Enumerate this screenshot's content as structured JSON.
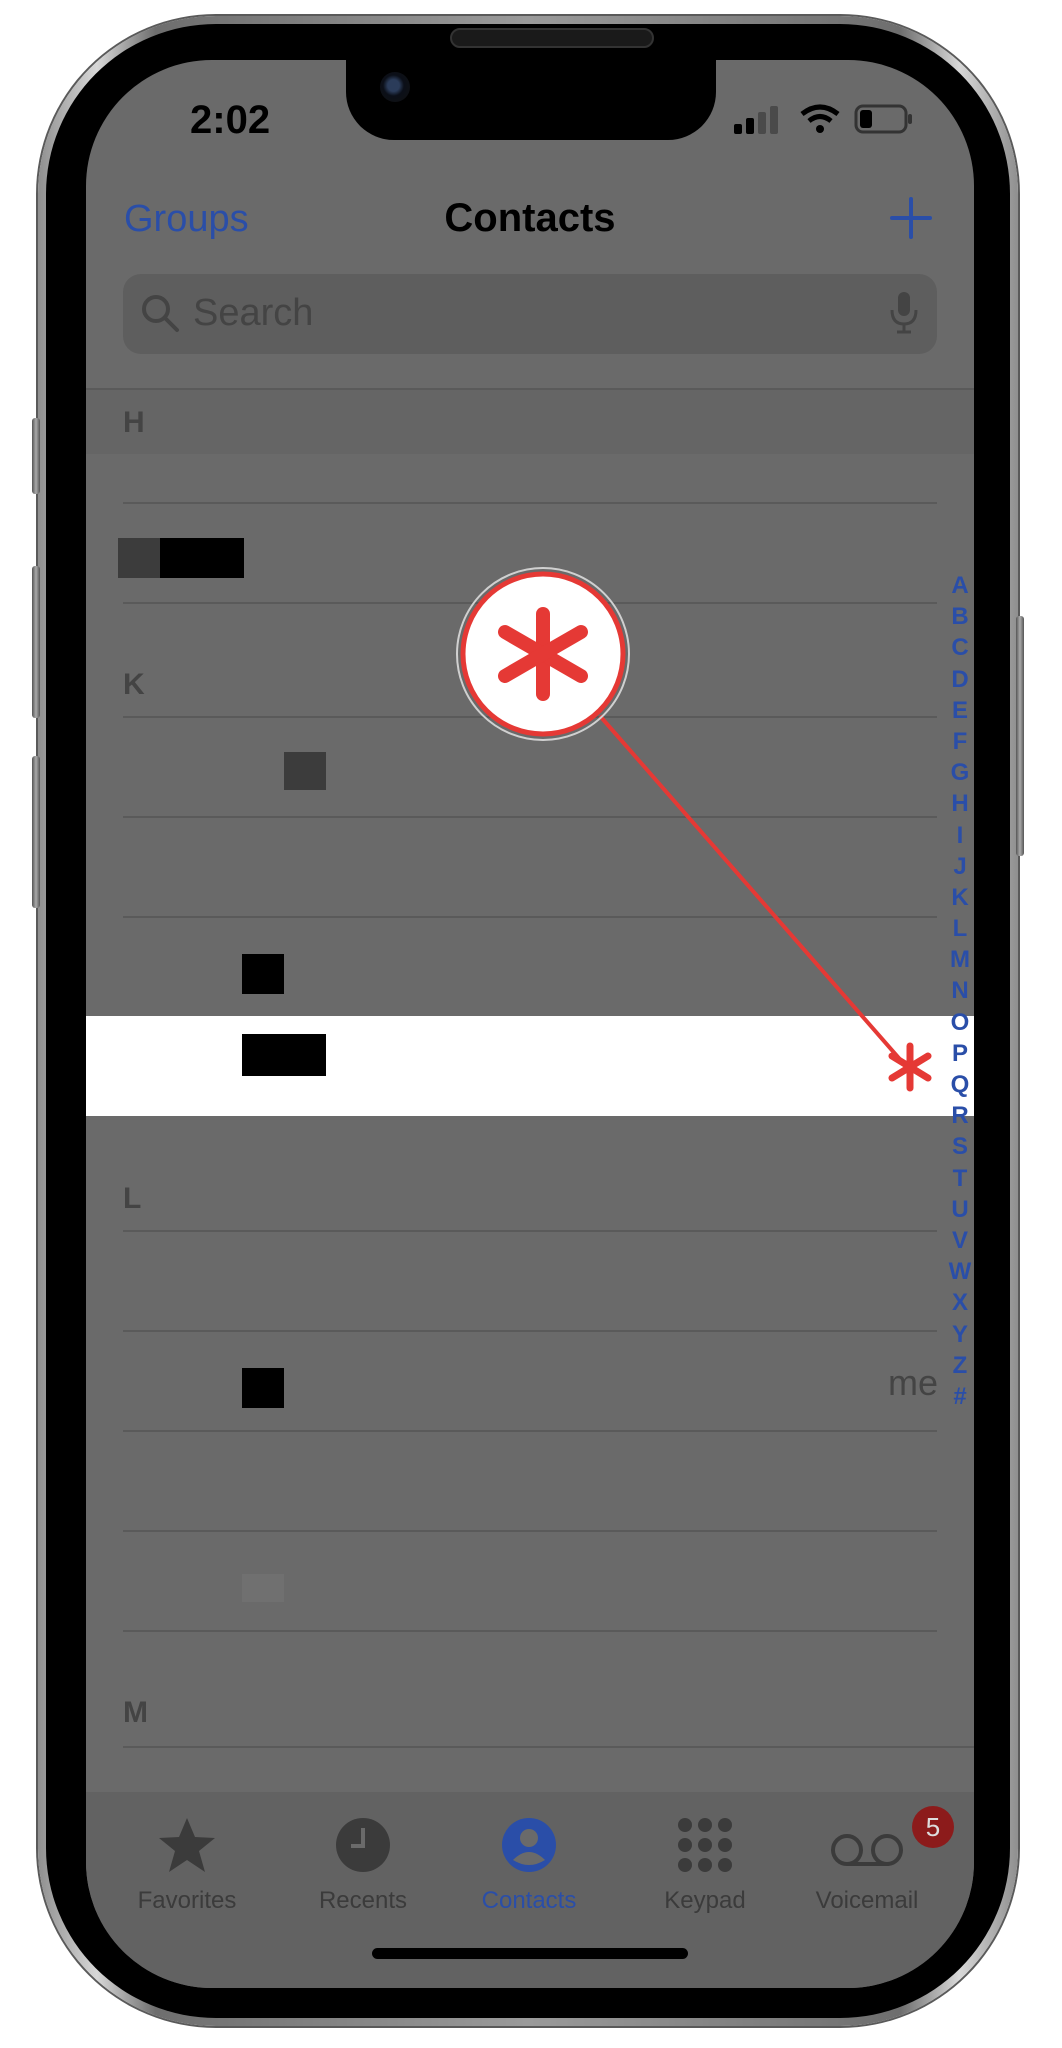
{
  "status_bar": {
    "time": "2:02"
  },
  "nav": {
    "left_link": "Groups",
    "title": "Contacts",
    "add_symbol": "+"
  },
  "search": {
    "placeholder": "Search"
  },
  "sections": [
    "H",
    "K",
    "L",
    "M"
  ],
  "index_letters": [
    "A",
    "B",
    "C",
    "D",
    "E",
    "F",
    "G",
    "H",
    "I",
    "J",
    "K",
    "L",
    "M",
    "N",
    "O",
    "P",
    "Q",
    "R",
    "S",
    "T",
    "U",
    "V",
    "W",
    "X",
    "Y",
    "Z",
    "#"
  ],
  "contact_me_label": "me",
  "tabs": [
    {
      "label": "Favorites",
      "icon": "star-icon"
    },
    {
      "label": "Recents",
      "icon": "clock-icon"
    },
    {
      "label": "Contacts",
      "icon": "person-icon",
      "active": true
    },
    {
      "label": "Keypad",
      "icon": "keypad-icon"
    },
    {
      "label": "Voicemail",
      "icon": "voicemail-icon"
    }
  ],
  "voicemail_badge": "5",
  "colors": {
    "accent": "#2a4ea8",
    "annotation": "#e53935",
    "dim_overlay": "#6a6a6a"
  }
}
